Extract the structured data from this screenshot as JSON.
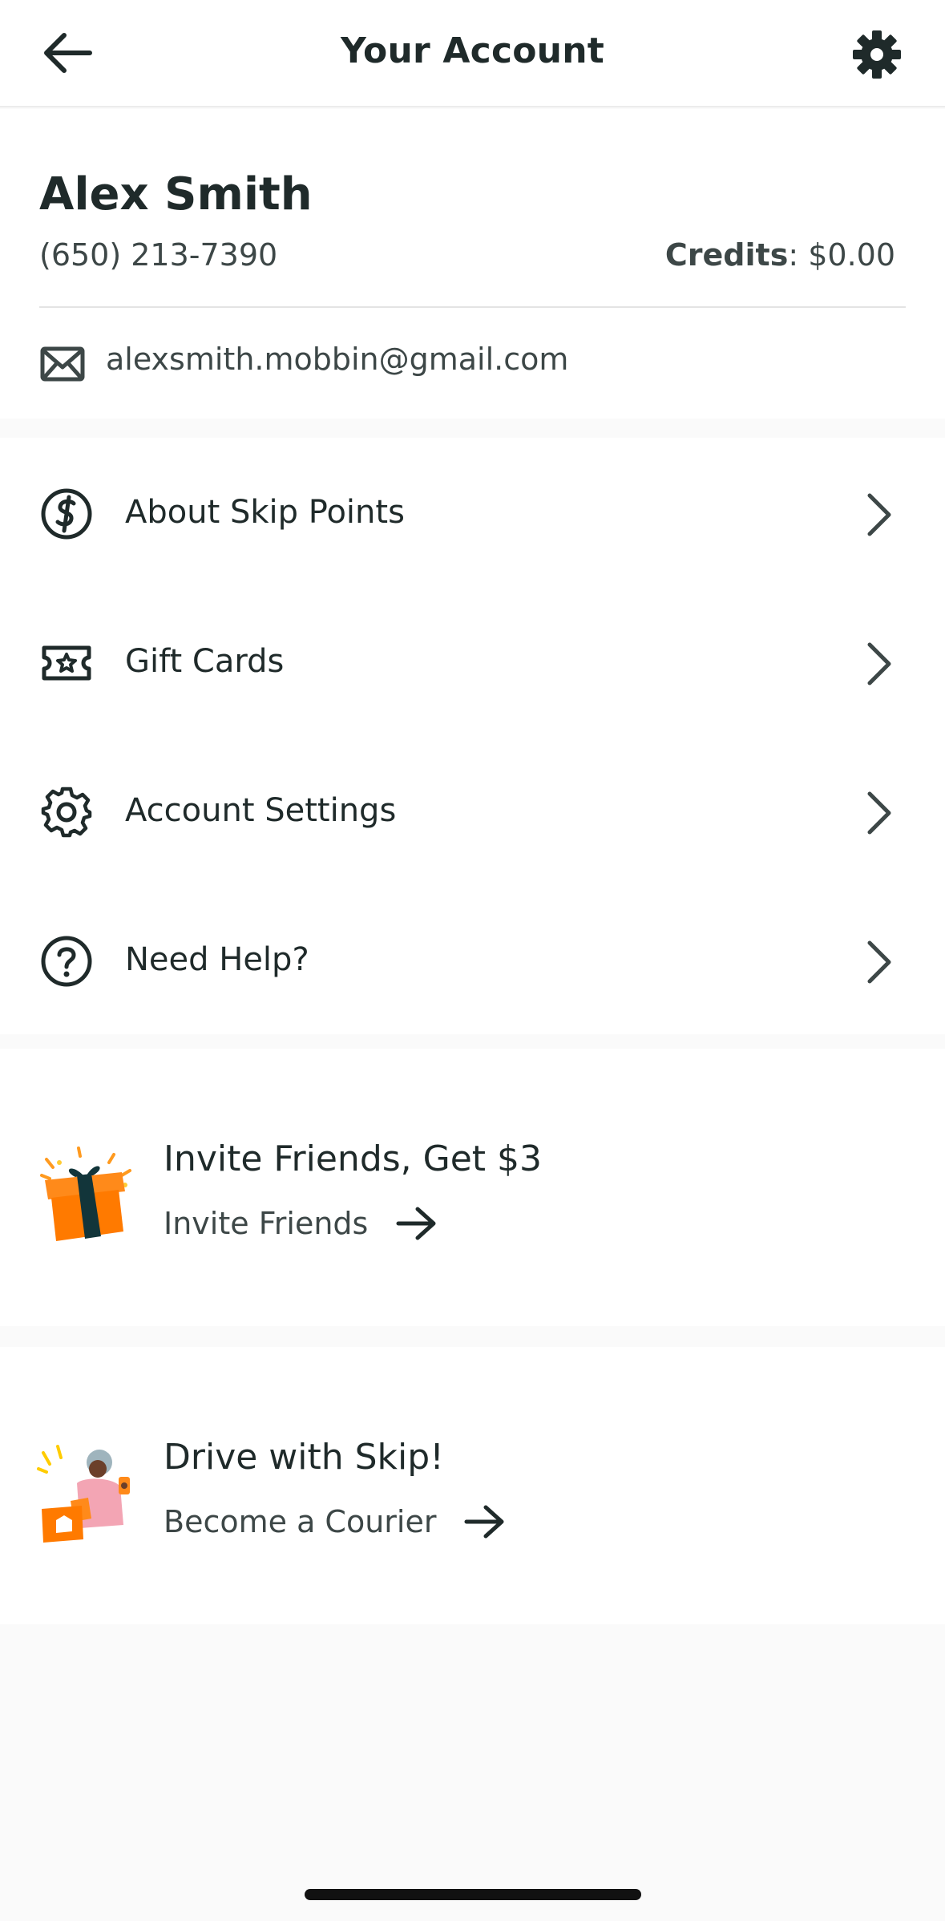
{
  "header": {
    "title": "Your Account"
  },
  "profile": {
    "name": "Alex Smith",
    "phone": "(650) 213-7390",
    "credits_label": "Credits",
    "credits_value": ": $0.00",
    "email": "alexsmith.mobbin@gmail.com"
  },
  "menu": {
    "items": [
      {
        "label": "About Skip Points",
        "icon": "skip-points-icon"
      },
      {
        "label": "Gift Cards",
        "icon": "gift-card-icon"
      },
      {
        "label": "Account Settings",
        "icon": "gear-icon"
      },
      {
        "label": "Need Help?",
        "icon": "help-icon"
      }
    ]
  },
  "promos": [
    {
      "title": "Invite Friends, Get $3",
      "link": "Invite Friends",
      "art": "gift-box-illustration"
    },
    {
      "title": "Drive with Skip!",
      "link": "Become a Courier",
      "art": "courier-illustration"
    }
  ],
  "colors": {
    "text": "#1f2a2a",
    "secondary_text": "#3d4747",
    "accent_orange": "#ff8000",
    "background": "#fafafa"
  }
}
